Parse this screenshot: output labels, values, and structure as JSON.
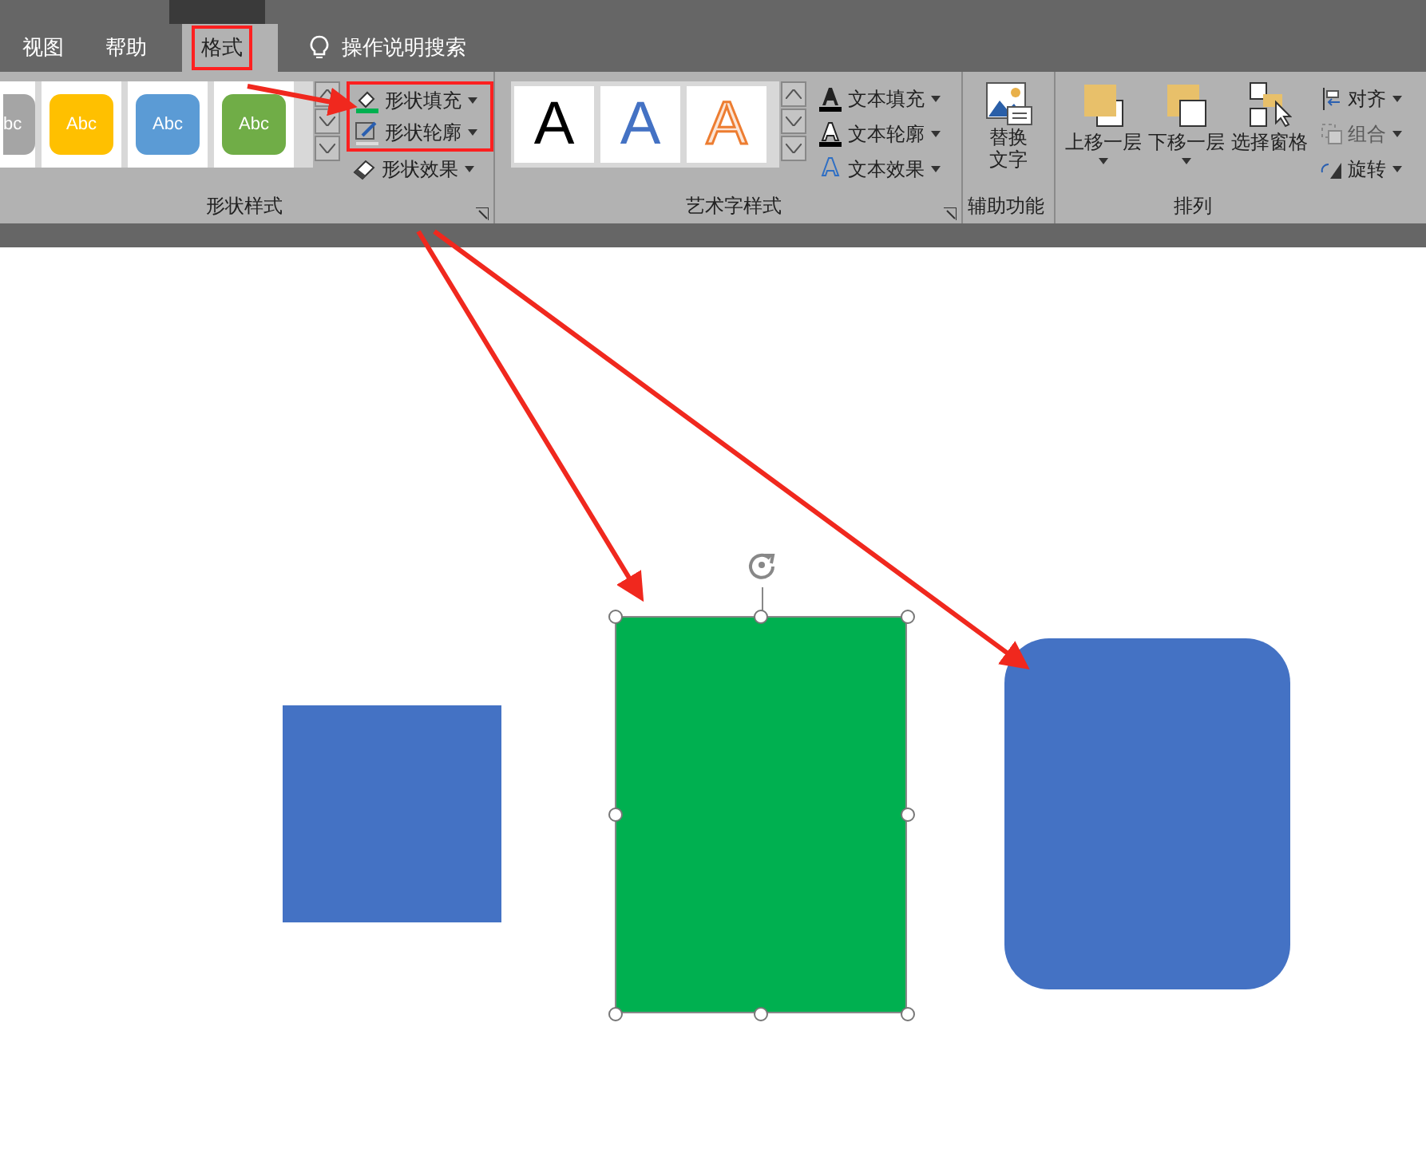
{
  "tabs": [
    {
      "label": "视图",
      "selected": false,
      "highlighted": false
    },
    {
      "label": "帮助",
      "selected": false,
      "highlighted": false
    },
    {
      "label": "格式",
      "selected": true,
      "highlighted": true
    }
  ],
  "search": {
    "label": "操作说明搜索"
  },
  "shape_styles": {
    "gallery": [
      {
        "label": "bc",
        "color": "#a5a5a5"
      },
      {
        "label": "Abc",
        "color": "#ffc000"
      },
      {
        "label": "Abc",
        "color": "#5b9bd5"
      },
      {
        "label": "Abc",
        "color": "#70ad47"
      }
    ],
    "commands": [
      {
        "label": "形状填充",
        "highlighted": true,
        "kind": "fill"
      },
      {
        "label": "形状轮廓",
        "highlighted": true,
        "kind": "outline"
      },
      {
        "label": "形状效果",
        "highlighted": false,
        "kind": "effect"
      }
    ],
    "group_label": "形状样式"
  },
  "wordart_styles": {
    "gallery": [
      {
        "label": "A",
        "kind": "plain"
      },
      {
        "label": "A",
        "kind": "blue"
      },
      {
        "label": "A",
        "kind": "outline"
      }
    ],
    "commands": [
      {
        "label": "文本填充",
        "kind": "fill"
      },
      {
        "label": "文本轮廓",
        "kind": "outline"
      },
      {
        "label": "文本效果",
        "kind": "effect"
      }
    ],
    "group_label": "艺术字样式"
  },
  "accessibility": {
    "button": [
      "替换",
      "文字"
    ],
    "group_label": "辅助功能"
  },
  "arrange": {
    "buttons": [
      {
        "label": "上移一层",
        "kind": "forward"
      },
      {
        "label": "下移一层",
        "kind": "backward"
      },
      {
        "label": "选择窗格",
        "kind": "pane"
      }
    ],
    "small_buttons": [
      {
        "label": "对齐",
        "kind": "align",
        "disabled": false
      },
      {
        "label": "组合",
        "kind": "group",
        "disabled": true
      },
      {
        "label": "旋转",
        "kind": "rotate",
        "disabled": false
      }
    ],
    "group_label": "排列"
  },
  "canvas": {
    "shapes": [
      {
        "kind": "square",
        "color": "#4472c4",
        "selected": false
      },
      {
        "kind": "rectangle",
        "color": "#00b050",
        "selected": true
      },
      {
        "kind": "rounded",
        "color": "#4472c4",
        "selected": false
      }
    ]
  }
}
